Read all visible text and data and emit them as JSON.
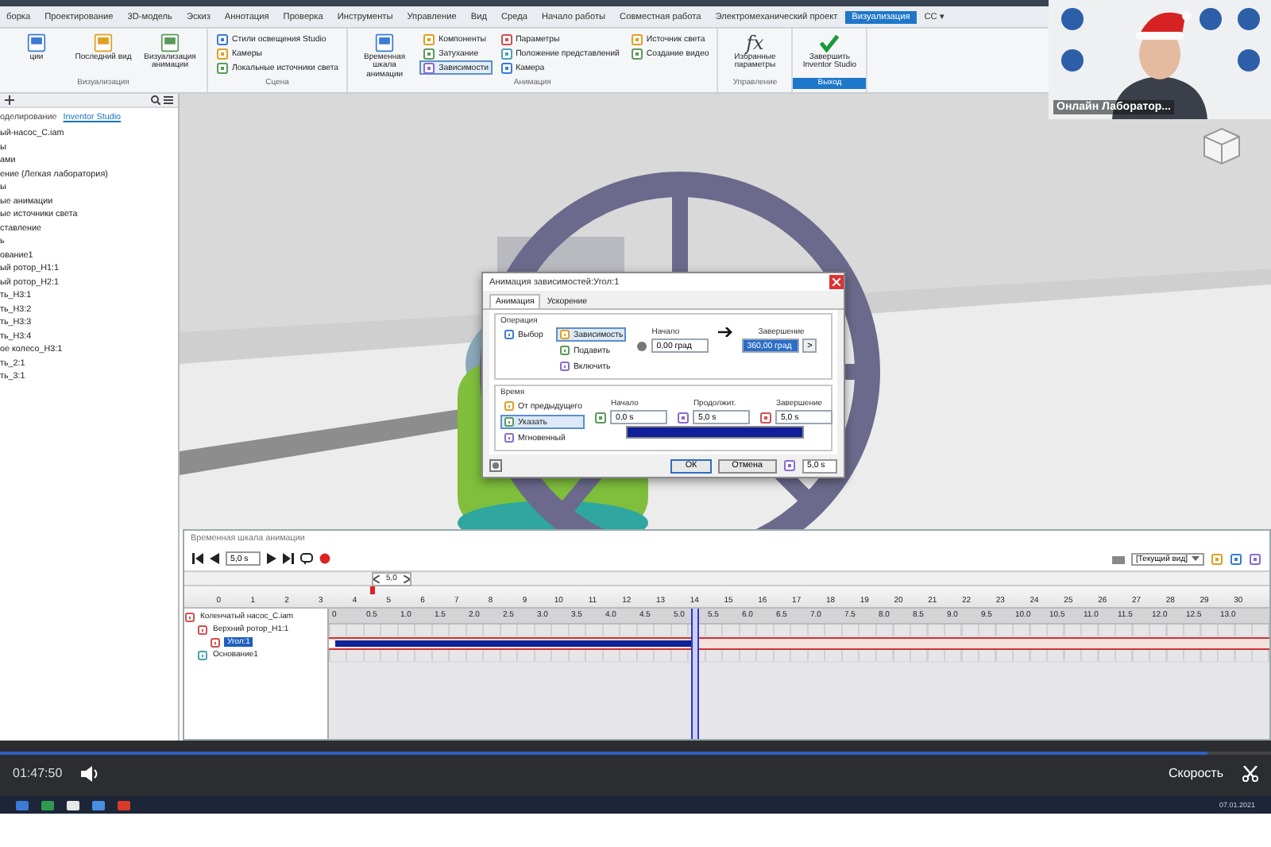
{
  "ribbon": {
    "tabs": [
      {
        "label": "борка",
        "selected": false
      },
      {
        "label": "Проектирование",
        "selected": false
      },
      {
        "label": "3D-модель",
        "selected": false
      },
      {
        "label": "Эскиз",
        "selected": false
      },
      {
        "label": "Аннотация",
        "selected": false
      },
      {
        "label": "Проверка",
        "selected": false
      },
      {
        "label": "Инструменты",
        "selected": false
      },
      {
        "label": "Управление",
        "selected": false
      },
      {
        "label": "Вид",
        "selected": false
      },
      {
        "label": "Среда",
        "selected": false
      },
      {
        "label": "Начало работы",
        "selected": false
      },
      {
        "label": "Совместная работа",
        "selected": false
      },
      {
        "label": "Электромеханический проект",
        "selected": false
      },
      {
        "label": "Визуализация",
        "selected": true
      },
      {
        "label": "CC ▾",
        "selected": false
      }
    ],
    "panels": [
      {
        "title": "Визуализация",
        "selected": false,
        "buttons": [
          {
            "kind": "large",
            "label": "ции",
            "selected": false
          },
          {
            "kind": "large",
            "label": "Последний вид",
            "selected": false
          },
          {
            "kind": "large",
            "label": "Визуализация анимации",
            "selected": false
          }
        ]
      },
      {
        "title": "Сцена",
        "selected": false,
        "buttons": [
          {
            "kind": "small",
            "label": "Стили освещения Studio",
            "selected": false
          },
          {
            "kind": "small",
            "label": "Камеры",
            "selected": false
          },
          {
            "kind": "small",
            "label": "Локальные источники света",
            "selected": false
          }
        ]
      },
      {
        "title": "Анимация",
        "selected": false,
        "buttons": [
          {
            "kind": "large",
            "label": "Временная шкала анимации",
            "selected": false
          },
          {
            "kind": "small",
            "label": "Компоненты",
            "selected": false
          },
          {
            "kind": "small",
            "label": "Затухание",
            "selected": false
          },
          {
            "kind": "small",
            "label": "Зависимости",
            "selected": true
          },
          {
            "kind": "small",
            "label": "Параметры",
            "selected": false
          },
          {
            "kind": "small",
            "label": "Положение представлений",
            "selected": false
          },
          {
            "kind": "small",
            "label": "Камера",
            "selected": false
          },
          {
            "kind": "small",
            "label": "Источник света",
            "selected": false
          },
          {
            "kind": "small",
            "label": "Создание видео",
            "selected": false
          }
        ]
      },
      {
        "title": "Управление",
        "selected": false,
        "buttons": [
          {
            "kind": "glyph",
            "glyph": "fx",
            "label": "Избранные параметры",
            "selected": false
          }
        ]
      },
      {
        "title": "Выход",
        "selected": true,
        "buttons": [
          {
            "kind": "finish",
            "label": "Завершить Inventor Studio",
            "selected": false
          }
        ]
      }
    ]
  },
  "webcam": {
    "caption": "Онлайн Лаборатор..."
  },
  "browser": {
    "tabs": [
      {
        "label": "оделирование",
        "selected": false
      },
      {
        "label": "Inventor Studio",
        "selected": true
      }
    ],
    "items": [
      "ый-насос_С.iam",
      "ы",
      "ами",
      "ение (Легкая лаборатория)",
      "ы",
      "ые анимации",
      "ые источники света",
      "ставление",
      "ь",
      "ование1",
      "ый ротор_H1:1",
      "ый ротор_H2:1",
      "ть_H3:1",
      "ть_H3:2",
      "ть_H3:3",
      "ть_H3:4",
      "ое колесо_H3:1",
      "ть_2:1",
      "ть_3:1"
    ]
  },
  "dialog": {
    "title": "Анимация зависимостей:Угол:1",
    "tabs": [
      {
        "label": "Анимация",
        "selected": true
      },
      {
        "label": "Ускорение",
        "selected": false
      }
    ],
    "operation": {
      "title": "Операция",
      "select_label": "Выбор",
      "modes": [
        {
          "label": "Зависимость",
          "selected": true
        },
        {
          "label": "Подавить",
          "selected": false
        },
        {
          "label": "Включить",
          "selected": false
        }
      ],
      "start_label": "Начало",
      "start_value": "0,00 град",
      "end_label": "Завершение",
      "end_value": "360,00 град",
      "more": ">"
    },
    "time": {
      "title": "Время",
      "modes": [
        {
          "label": "От предыдущего",
          "selected": false
        },
        {
          "label": "Указать",
          "selected": true
        },
        {
          "label": "Мгновенный",
          "selected": false
        }
      ],
      "fields": [
        {
          "label": "Начало",
          "value": "0,0 s"
        },
        {
          "label": "Продолжит.",
          "value": "5,0 s"
        },
        {
          "label": "Завершение",
          "value": "5,0 s"
        }
      ],
      "slider": {
        "level": 1
      }
    },
    "buttons": [
      "ОК",
      "Отмена"
    ],
    "duration": "5,0 s"
  },
  "timeline": {
    "title": "Временная шкала анимации",
    "time_value": "5,0 s",
    "view": "[Текущий вид]",
    "scrub_value": "5,0",
    "scrub": {
      "level": 0.1667
    },
    "ruler": [
      "0",
      "1",
      "2",
      "3",
      "4",
      "5",
      "6",
      "7",
      "8",
      "9",
      "10",
      "11",
      "12",
      "13",
      "14",
      "15",
      "16",
      "17",
      "18",
      "19",
      "20",
      "21",
      "22",
      "23",
      "24",
      "25",
      "26",
      "27",
      "28",
      "29",
      "30"
    ],
    "grid": [
      "0",
      "0.5",
      "1.0",
      "1.5",
      "2.0",
      "2.5",
      "3.0",
      "3.5",
      "4.0",
      "4.5",
      "5.0",
      "5.5",
      "6.0",
      "6.5",
      "7.0",
      "7.5",
      "8.0",
      "8.5",
      "9.0",
      "9.5",
      "10.0",
      "10.5",
      "11.0",
      "11.5",
      "12.0",
      "12.5",
      "13.0"
    ],
    "tree": [
      {
        "label": "Коленчатый насос_С.iam",
        "selected": false,
        "children": [
          {
            "label": "Верхний ротор_H1:1",
            "selected": false,
            "children": [
              {
                "label": "Угол:1",
                "selected": true
              }
            ]
          },
          {
            "label": "Основание1",
            "selected": false
          }
        ]
      }
    ],
    "action": {
      "level": 0.385
    },
    "playhead": {
      "level": 0.385
    }
  },
  "player": {
    "time": "01:47:50",
    "speed": "Скорость",
    "progress": {
      "level": 0.95
    }
  },
  "taskbar": {
    "date": "07.01.2021"
  }
}
